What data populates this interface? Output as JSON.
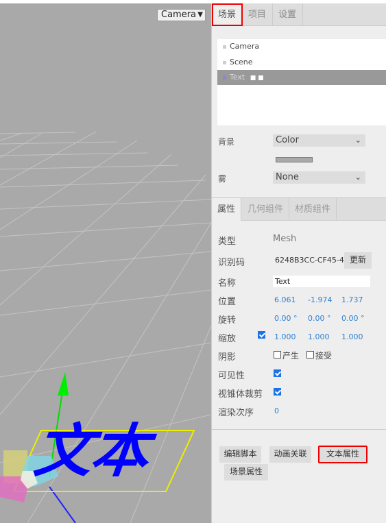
{
  "viewport": {
    "camera_select": "Camera",
    "overlay_text": "文本"
  },
  "sidebar": {
    "tabs": [
      "场景",
      "项目",
      "设置"
    ],
    "outliner": [
      {
        "label": "Camera"
      },
      {
        "label": "Scene"
      },
      {
        "label": "Text",
        "dots": "■ ■"
      }
    ],
    "background_label": "背景",
    "background_value": "Color",
    "fog_label": "雾",
    "fog_value": "None",
    "tabs2": [
      "属性",
      "几何组件",
      "材质组件"
    ],
    "props": {
      "type_label": "类型",
      "type_value": "Mesh",
      "uuid_label": "识别码",
      "uuid_value": "6248B3CC-CF45-4",
      "renew_button": "更新",
      "name_label": "名称",
      "name_value": "Text",
      "position_label": "位置",
      "position": [
        "6.061",
        "-1.974",
        "1.737"
      ],
      "rotation_label": "旋转",
      "rotation": [
        "0.00 °",
        "0.00 °",
        "0.00 °"
      ],
      "scale_label": "缩放",
      "scale": [
        "1.000",
        "1.000",
        "1.000"
      ],
      "shadow_label": "阴影",
      "cast_label": "产生",
      "receive_label": "接受",
      "visible_label": "可见性",
      "frustum_label": "视锥体裁剪",
      "render_order_label": "渲染次序",
      "render_order_value": "0"
    },
    "buttons": [
      "编辑脚本",
      "动画关联",
      "文本属性",
      "场景属性"
    ]
  },
  "colors": {
    "highlight": "#e00000",
    "accent": "#2a7fd0",
    "viewport_bg": "#a9a9a9"
  }
}
